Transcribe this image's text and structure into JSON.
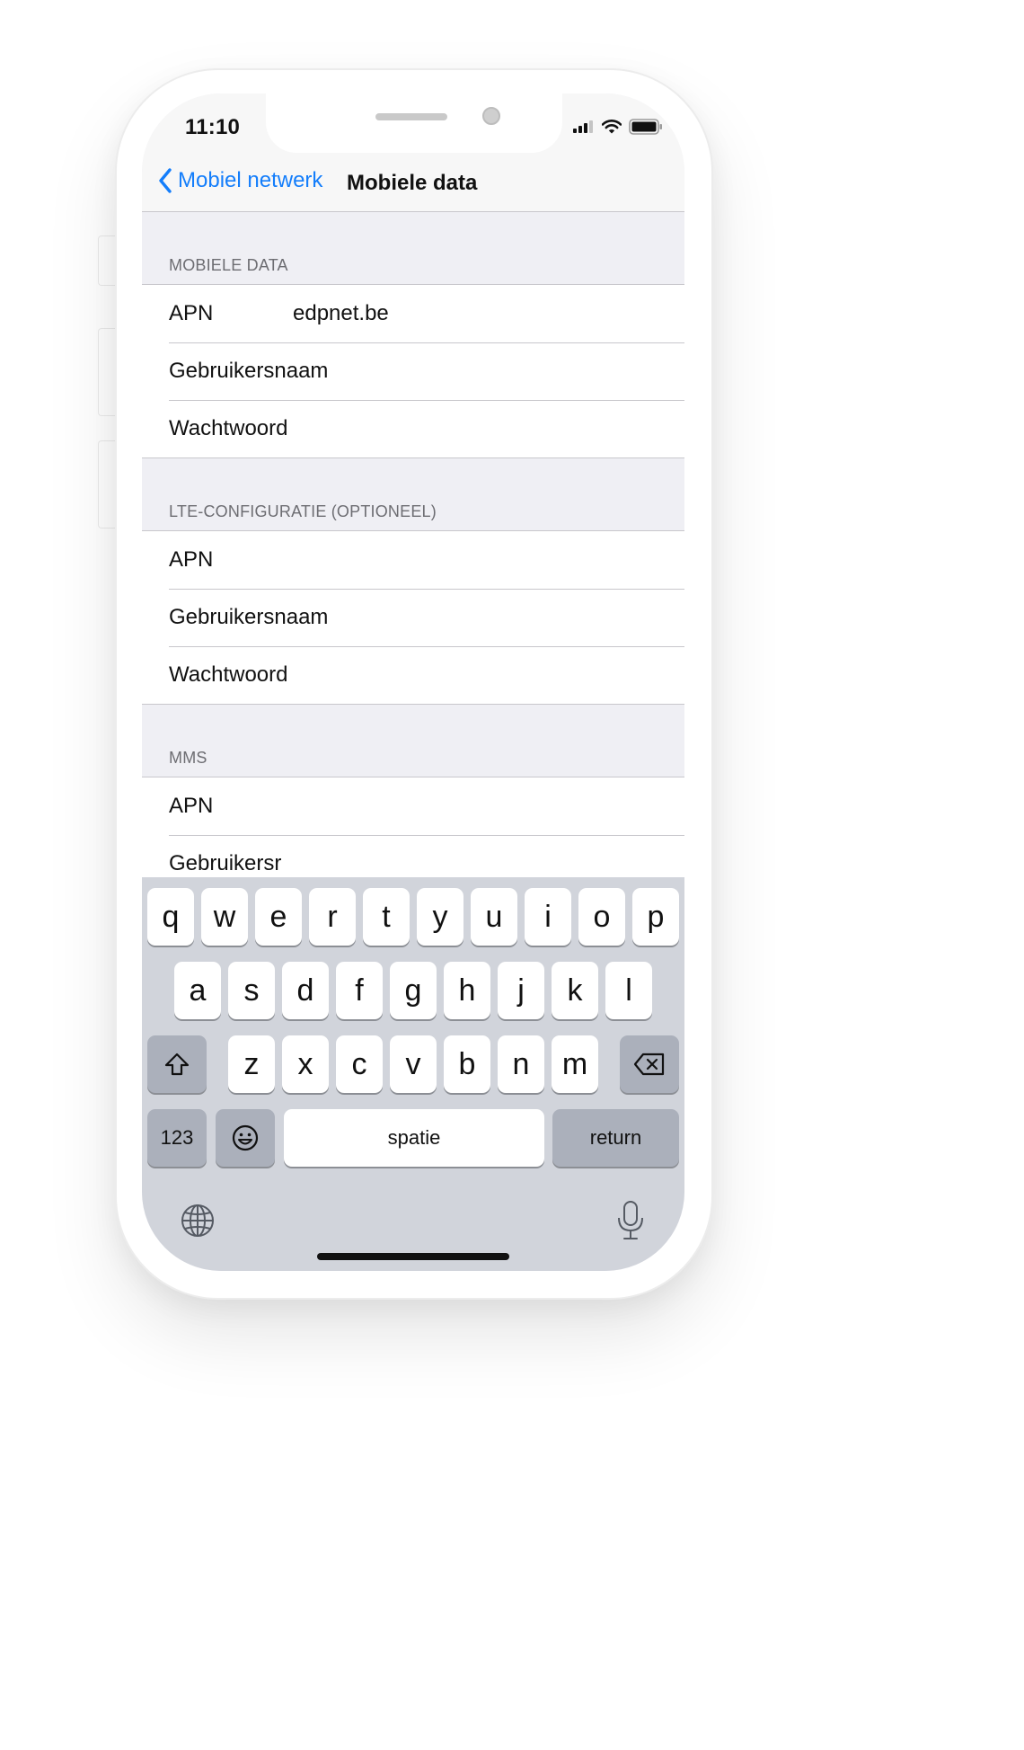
{
  "status_bar": {
    "time": "11:10"
  },
  "nav": {
    "back_label": "Mobiel netwerk",
    "title": "Mobiele data"
  },
  "sections": [
    {
      "header": "MOBIELE DATA",
      "rows": [
        {
          "label": "APN",
          "value": "edpnet.be"
        },
        {
          "label": "Gebruikersnaam",
          "value": ""
        },
        {
          "label": "Wachtwoord",
          "value": ""
        }
      ]
    },
    {
      "header": "LTE-CONFIGURATIE (OPTIONEEL)",
      "rows": [
        {
          "label": "APN",
          "value": ""
        },
        {
          "label": "Gebruikersnaam",
          "value": ""
        },
        {
          "label": "Wachtwoord",
          "value": ""
        }
      ]
    },
    {
      "header": "MMS",
      "rows": [
        {
          "label": "APN",
          "value": ""
        },
        {
          "label": "Gebruikersr",
          "value": ""
        }
      ]
    }
  ],
  "keyboard": {
    "row1": [
      "q",
      "w",
      "e",
      "r",
      "t",
      "y",
      "u",
      "i",
      "o",
      "p"
    ],
    "row2": [
      "a",
      "s",
      "d",
      "f",
      "g",
      "h",
      "j",
      "k",
      "l"
    ],
    "row3": [
      "z",
      "x",
      "c",
      "v",
      "b",
      "n",
      "m"
    ],
    "numbers_label": "123",
    "space_label": "spatie",
    "return_label": "return"
  },
  "icons": {
    "back": "chevron-left-icon",
    "signal": "cellular-signal-icon",
    "wifi": "wifi-icon",
    "battery": "battery-icon",
    "shift": "shift-icon",
    "delete": "backspace-icon",
    "emoji": "emoji-icon",
    "globe": "globe-icon",
    "microphone": "microphone-icon"
  },
  "colors": {
    "accent": "#147efb",
    "grouped_background": "#efeff4",
    "keyboard_background": "#d1d4db"
  }
}
